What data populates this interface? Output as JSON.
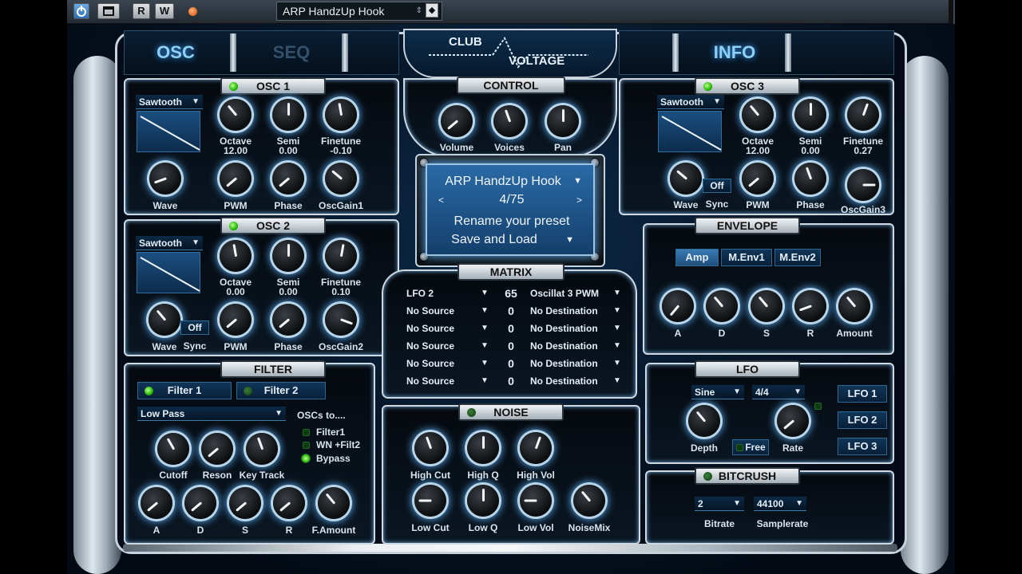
{
  "host": {
    "power_icon": "power-icon",
    "window_icon": "window-icon",
    "read_label": "R",
    "write_label": "W",
    "preset_name": "ARP HandzUp Hook"
  },
  "tabs": {
    "osc": "OSC",
    "seq": "SEQ",
    "info": "INFO"
  },
  "logo": {
    "line1": "CLUB",
    "line2": "VOLTAGE"
  },
  "osc1": {
    "title": "OSC 1",
    "waveform": "Sawtooth",
    "octave_label": "Octave",
    "octave_value": "12.00",
    "semi_label": "Semi",
    "semi_value": "0.00",
    "finetune_label": "Finetune",
    "finetune_value": "-0.10",
    "wave_label": "Wave",
    "pwm_label": "PWM",
    "phase_label": "Phase",
    "gain_label": "OscGain1"
  },
  "osc2": {
    "title": "OSC 2",
    "waveform": "Sawtooth",
    "octave_label": "Octave",
    "octave_value": "0.00",
    "semi_label": "Semi",
    "semi_value": "0.00",
    "finetune_label": "Finetune",
    "finetune_value": "0.10",
    "wave_label": "Wave",
    "sync_label": "Sync",
    "sync_value": "Off",
    "pwm_label": "PWM",
    "phase_label": "Phase",
    "gain_label": "OscGain2"
  },
  "osc3": {
    "title": "OSC 3",
    "waveform": "Sawtooth",
    "octave_label": "Octave",
    "octave_value": "12.00",
    "semi_label": "Semi",
    "semi_value": "0.00",
    "finetune_label": "Finetune",
    "finetune_value": "0.27",
    "wave_label": "Wave",
    "sync_label": "Sync",
    "sync_value": "Off",
    "pwm_label": "PWM",
    "phase_label": "Phase",
    "gain_label": "OscGain3"
  },
  "control": {
    "title": "CONTROL",
    "volume_label": "Volume",
    "voices_label": "Voices",
    "pan_label": "Pan"
  },
  "display": {
    "preset_name": "ARP HandzUp Hook",
    "prev": "<",
    "next": ">",
    "preset_index": "4/75",
    "rename": "Rename your preset",
    "save_load": "Save and Load"
  },
  "matrix": {
    "title": "MATRIX",
    "rows": [
      {
        "source": "LFO 2",
        "amount": "65",
        "destination": "Oscillat 3 PWM"
      },
      {
        "source": "No Source",
        "amount": "0",
        "destination": "No Destination"
      },
      {
        "source": "No Source",
        "amount": "0",
        "destination": "No Destination"
      },
      {
        "source": "No Source",
        "amount": "0",
        "destination": "No Destination"
      },
      {
        "source": "No Source",
        "amount": "0",
        "destination": "No Destination"
      },
      {
        "source": "No Source",
        "amount": "0",
        "destination": "No Destination"
      }
    ]
  },
  "envelope": {
    "title": "ENVELOPE",
    "tabs": [
      "Amp",
      "M.Env1",
      "M.Env2"
    ],
    "a_label": "A",
    "d_label": "D",
    "s_label": "S",
    "r_label": "R",
    "amount_label": "Amount"
  },
  "filter": {
    "title": "FILTER",
    "filter1_label": "Filter 1",
    "filter2_label": "Filter 2",
    "type": "Low Pass",
    "oscs_to_label": "OSCs to....",
    "routes": [
      "Filter1",
      "WN +Filt2",
      "Bypass"
    ],
    "cutoff_label": "Cutoff",
    "reson_label": "Reson",
    "keytrack_label": "Key Track",
    "a_label": "A",
    "d_label": "D",
    "s_label": "S",
    "r_label": "R",
    "famount_label": "F.Amount"
  },
  "noise": {
    "title": "NOISE",
    "highcut_label": "High Cut",
    "highq_label": "High Q",
    "highvol_label": "High Vol",
    "lowcut_label": "Low Cut",
    "lowq_label": "Low Q",
    "lowvol_label": "Low Vol",
    "noisemix_label": "NoiseMix"
  },
  "lfo": {
    "title": "LFO",
    "shape": "Sine",
    "division": "4/4",
    "depth_label": "Depth",
    "free_label": "Free",
    "rate_label": "Rate",
    "lfo1": "LFO 1",
    "lfo2": "LFO 2",
    "lfo3": "LFO 3"
  },
  "bitcrush": {
    "title": "BITCRUSH",
    "bitrate": "2",
    "samplerate": "44100",
    "bitrate_label": "Bitrate",
    "samplerate_label": "Samplerate"
  },
  "colors": {
    "accent": "#5fb4ff",
    "led_on": "#23b800",
    "panel": "#05090f"
  }
}
